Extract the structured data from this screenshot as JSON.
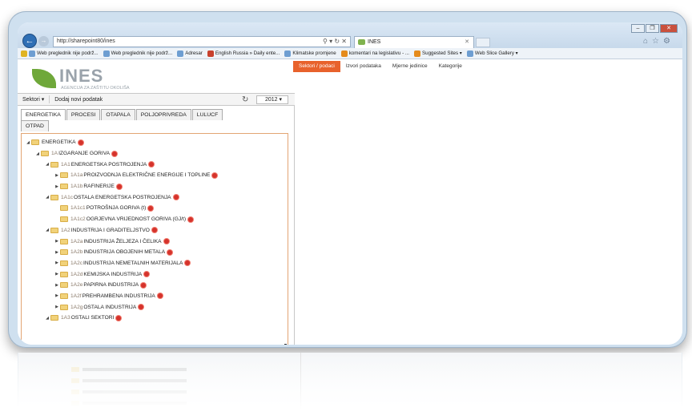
{
  "browser": {
    "url": "http://sharepoint80/ines",
    "tab_title": "INES",
    "favorites": [
      "Web preglednik nije podrž...",
      "Web preglednik nije podrž...",
      "Adresar",
      "English Russia » Daily ente...",
      "Klimatske promjene",
      "komentari na legislativu - ...",
      "Suggested Sites ▾",
      "Web Slice Gallery ▾"
    ]
  },
  "app": {
    "name": "INES",
    "subtitle": "AGENCIJA ZA ZAŠTITU OKOLIŠA"
  },
  "topnav": [
    "Sektori / podaci",
    "Izvori podataka",
    "Mjerne jedinice",
    "Kategorije"
  ],
  "toolbar": {
    "sektori": "Sektori ▾",
    "add": "Dodaj novi podatak",
    "year": "2012 ▾"
  },
  "tabs": [
    "ENERGETIKA",
    "PROCESI",
    "OTAPALA",
    "POLJOPRIVREDA",
    "LULUCF",
    "OTPAD"
  ],
  "tree": [
    {
      "level": 0,
      "arrow": "◢",
      "code": "",
      "label": "ENERGETIKA"
    },
    {
      "level": 1,
      "arrow": "◢",
      "code": "1A",
      "label": "IZGARANJE GORIVA"
    },
    {
      "level": 2,
      "arrow": "◢",
      "code": "1A1",
      "label": "ENERGETSKA POSTROJENJA"
    },
    {
      "level": 3,
      "arrow": "▶",
      "code": "1A1a",
      "label": "PROIZVODNJA ELEKTRIČNE ENERGIJE I TOPLINE"
    },
    {
      "level": 3,
      "arrow": "▶",
      "code": "1A1b",
      "label": "RAFINERIJE"
    },
    {
      "level": 2,
      "arrow": "◢",
      "code": "1A1c",
      "label": "OSTALA ENERGETSKA POSTROJENJA"
    },
    {
      "level": 3,
      "arrow": "",
      "code": "1A1c1",
      "label": "POTROŠNJA GORIVA (t)"
    },
    {
      "level": 3,
      "arrow": "",
      "code": "1A1c2",
      "label": "OGRJEVNA VRIJEDNOST GORIVA (GJ/t)"
    },
    {
      "level": 2,
      "arrow": "◢",
      "code": "1A2",
      "label": "INDUSTRIJA I GRADITELJSTVO"
    },
    {
      "level": 3,
      "arrow": "▶",
      "code": "1A2a",
      "label": "INDUSTRIJA ŽELJEZA I ČELIKA"
    },
    {
      "level": 3,
      "arrow": "▶",
      "code": "1A2b",
      "label": "INDUSTRIJA OBOJENIH METALA"
    },
    {
      "level": 3,
      "arrow": "▶",
      "code": "1A2c",
      "label": "INDUSTRIJA NEMETALNIH MATERIJALA"
    },
    {
      "level": 3,
      "arrow": "▶",
      "code": "1A2d",
      "label": "KEMIJSKA INDUSTRIJA"
    },
    {
      "level": 3,
      "arrow": "▶",
      "code": "1A2e",
      "label": "PAPIRNA INDUSTRIJA"
    },
    {
      "level": 3,
      "arrow": "▶",
      "code": "1A2f",
      "label": "PREHRAMBENA INDUSTRIJA"
    },
    {
      "level": 3,
      "arrow": "▶",
      "code": "1A2g",
      "label": "OSTALA INDUSTRIJA"
    },
    {
      "level": 2,
      "arrow": "◢",
      "code": "1A3",
      "label": "OSTALI SEKTORI"
    }
  ]
}
